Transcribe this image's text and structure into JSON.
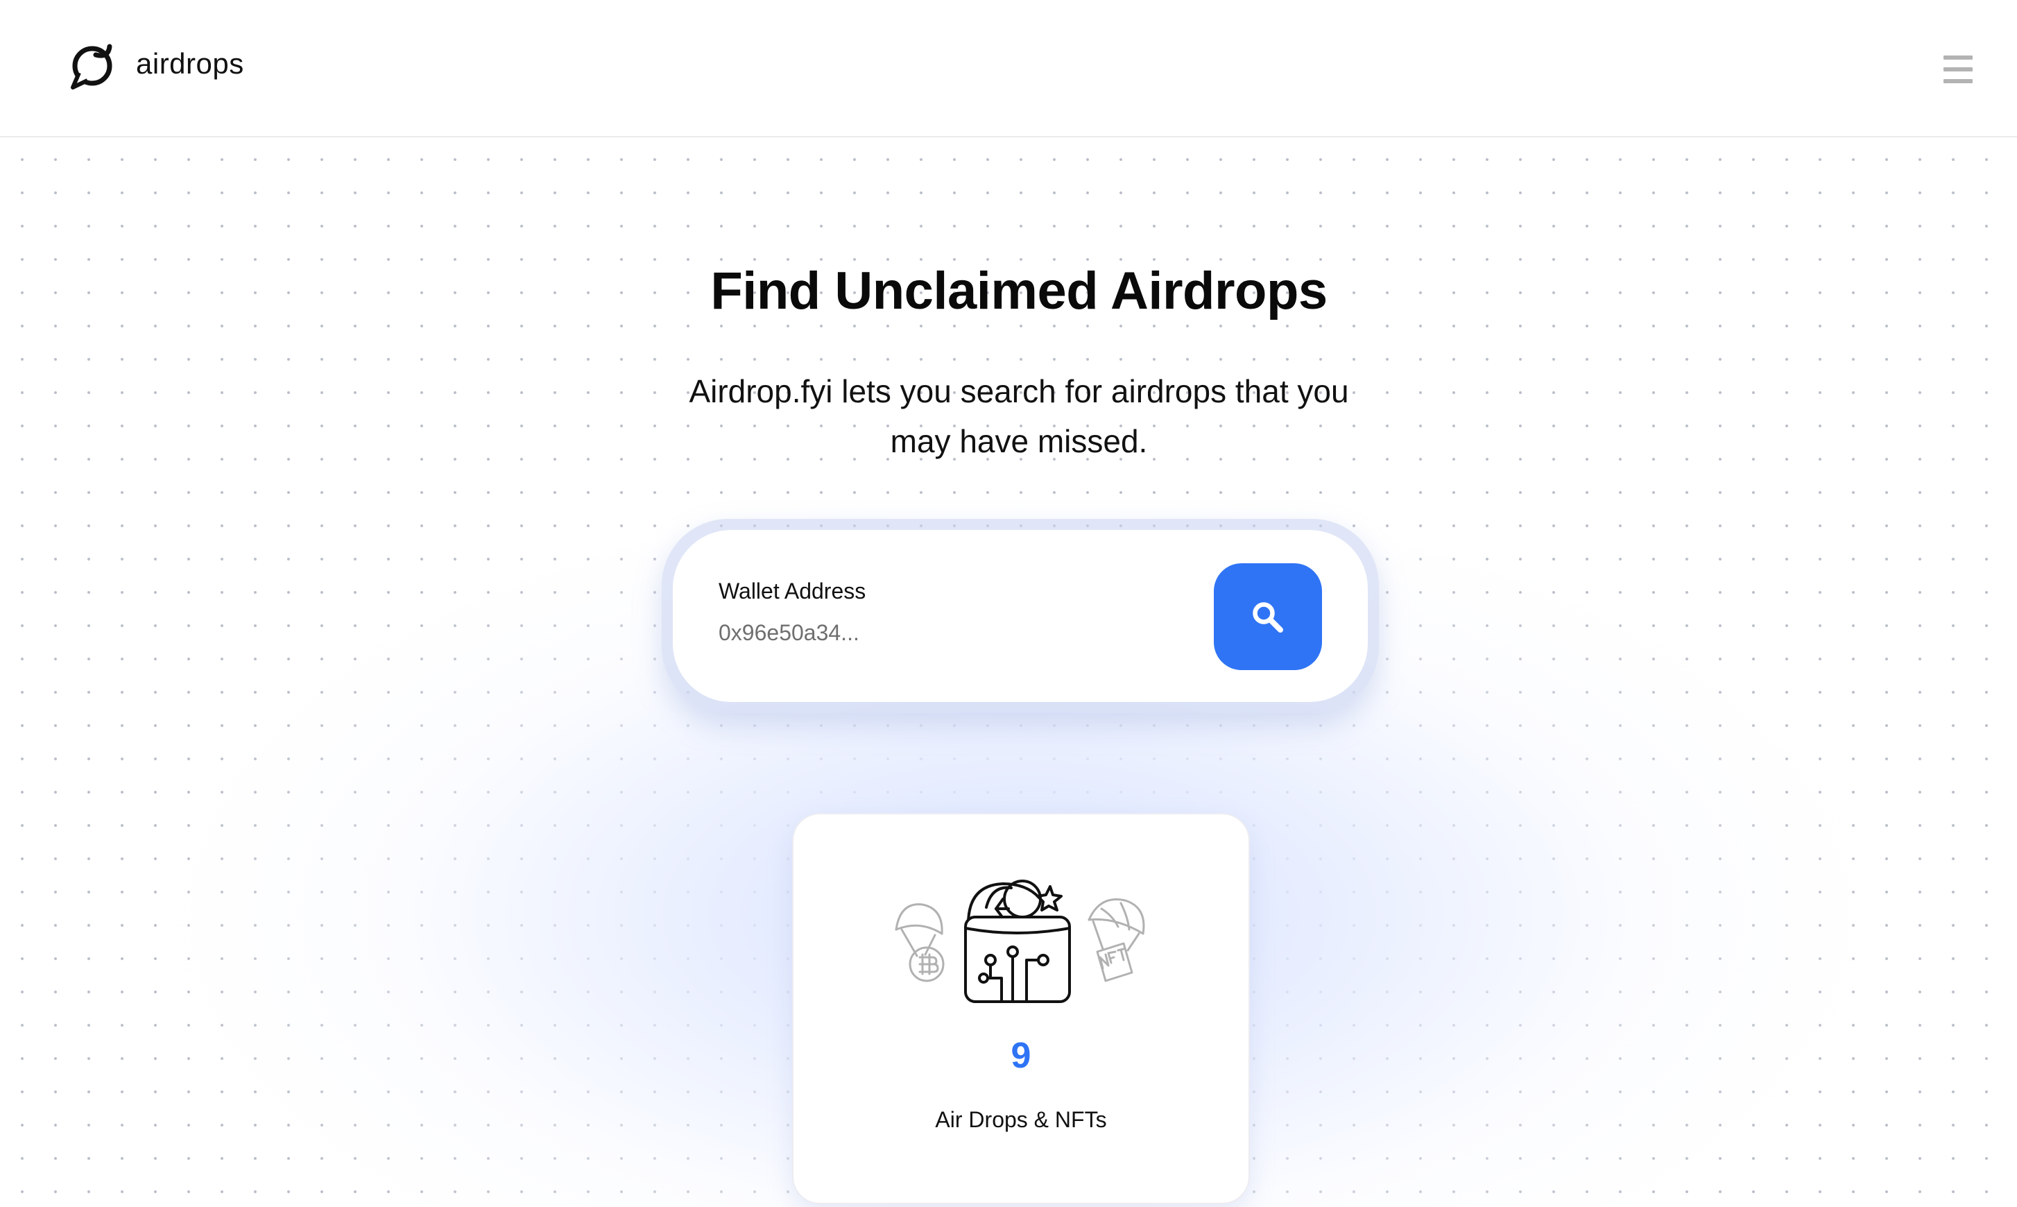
{
  "header": {
    "brand": "airdrops",
    "logo_icon": "airdrops-logo-icon",
    "menu_icon": "hamburger-menu-icon"
  },
  "hero": {
    "title": "Find Unclaimed Airdrops",
    "subtitle": "Airdrop.fyi lets you search for airdrops that you may have missed."
  },
  "search": {
    "label": "Wallet Address",
    "placeholder": "0x96e50a34...",
    "value": "",
    "button_icon": "search-icon",
    "accent_color": "#2f74f5"
  },
  "stats": [
    {
      "value": "9",
      "label": "Air Drops & NFTs",
      "icons": [
        "bitcoin-parachute-icon",
        "crypto-wallet-icon",
        "nft-parachute-icon"
      ]
    }
  ]
}
